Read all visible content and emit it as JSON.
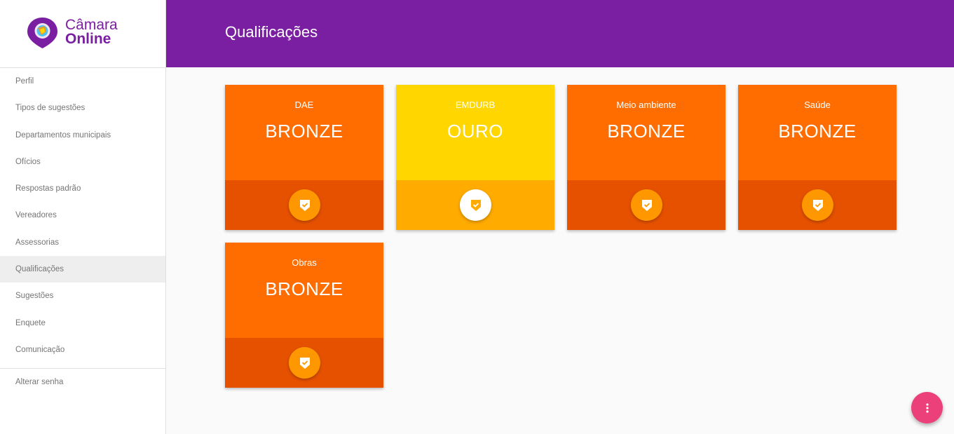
{
  "brand": {
    "line1": "Câmara",
    "line2": "Online",
    "logo_icon": "map-pin-icon"
  },
  "sidebar": {
    "items": [
      {
        "label": "Perfil"
      },
      {
        "label": "Tipos de sugestões"
      },
      {
        "label": "Departamentos municipais"
      },
      {
        "label": "Ofícios"
      },
      {
        "label": "Respostas padrão"
      },
      {
        "label": "Vereadores"
      },
      {
        "label": "Assessorias"
      },
      {
        "label": "Qualificações",
        "active": true
      },
      {
        "label": "Sugestões"
      },
      {
        "label": "Enquete"
      },
      {
        "label": "Comunicação"
      }
    ],
    "bottom_items": [
      {
        "label": "Alterar senha"
      }
    ]
  },
  "header": {
    "title": "Qualificações"
  },
  "qualifications": [
    {
      "name": "DAE",
      "level": "BRONZE",
      "tier": "bronze"
    },
    {
      "name": "EMDURB",
      "level": "OURO",
      "tier": "gold"
    },
    {
      "name": "Meio ambiente",
      "level": "BRONZE",
      "tier": "bronze"
    },
    {
      "name": "Saúde",
      "level": "BRONZE",
      "tier": "bronze"
    },
    {
      "name": "Obras",
      "level": "BRONZE",
      "tier": "bronze"
    }
  ],
  "colors": {
    "primary": "#7b1fa2",
    "bronze_top": "#ff6d00",
    "bronze_bottom": "#e65100",
    "bronze_badge": "#ff9800",
    "gold_top": "#ffd600",
    "gold_bottom": "#ffab00",
    "fab": "#ec407a"
  },
  "fab": {
    "icon": "more-vert-icon"
  }
}
